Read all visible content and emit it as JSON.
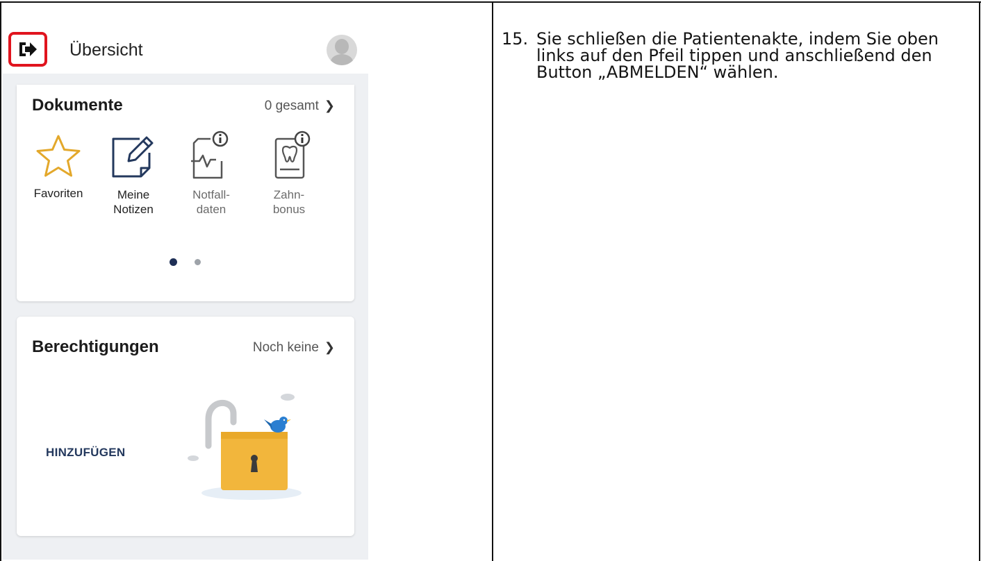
{
  "app_bar": {
    "title": "Übersicht",
    "exit_icon": "sign-out-arrow-icon",
    "highlight_color": "#e0141e",
    "avatar_icon": "user-avatar-icon"
  },
  "documents_card": {
    "title": "Dokumente",
    "link": "0 gesamt",
    "link_icon": "chevron-right-icon",
    "tiles": [
      {
        "label": "Favoriten",
        "icon": "star-icon"
      },
      {
        "label": "Meine\nNotizen",
        "icon": "note-edit-icon"
      },
      {
        "label": "Notfall-\ndaten",
        "icon": "emergency-data-icon"
      },
      {
        "label": "Zahn-\nbonus",
        "icon": "dental-bonus-icon"
      }
    ],
    "pager": {
      "pages": 2,
      "active": 1
    }
  },
  "permissions_card": {
    "title": "Berechtigungen",
    "link": "Noch keine",
    "link_icon": "chevron-right-icon",
    "add_button": "HINZUFÜGEN",
    "illustration_icon": "open-padlock-bird-icon"
  },
  "instruction": {
    "number": "15.",
    "text": "Sie schließen die Patientenakte, indem Sie oben links auf den Pfeil tippen und anschließend den Button „ABMELDEN“ wählen."
  },
  "colors": {
    "accent_navy": "#23385d",
    "star": "#e3a82b",
    "lock": "#f2b63c"
  }
}
